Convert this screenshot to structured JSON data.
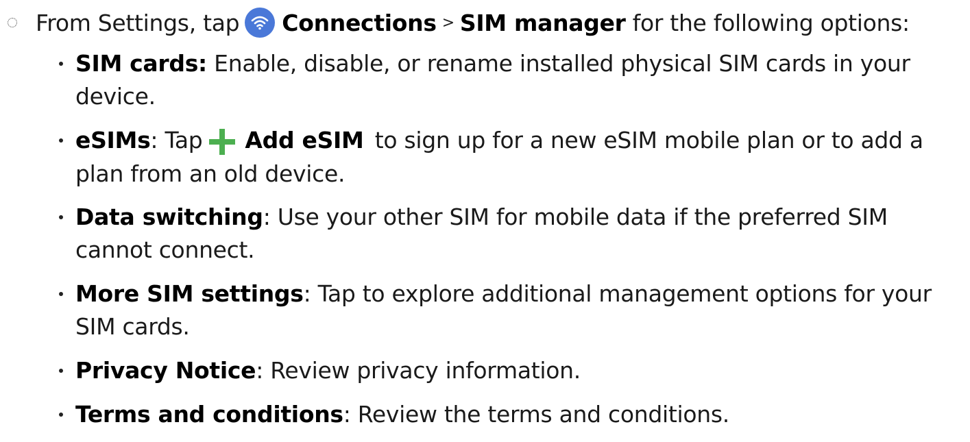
{
  "intro": {
    "prefix": "From Settings, tap",
    "connections": "Connections",
    "separator": ">",
    "sim_manager": "SIM manager",
    "suffix": "for the following options:",
    "connections_icon": "wifi-icon",
    "icon_color": "#4a78d8"
  },
  "options": [
    {
      "term": "SIM cards:",
      "text": "Enable, disable, or rename installed physical SIM cards in your device."
    },
    {
      "term": "eSIMs",
      "colon": ":",
      "text_before": "Tap",
      "action_icon": "plus-icon",
      "action_icon_color": "#4caf50",
      "action_label": "Add eSIM",
      "text_after": "to sign up for a new eSIM mobile plan or to add a plan from an old device."
    },
    {
      "term": "Data switching",
      "colon": ":",
      "text": "Use your other SIM for mobile data if the preferred SIM cannot connect."
    },
    {
      "term": "More SIM settings",
      "colon": ":",
      "text": "Tap to explore additional management options for your SIM cards."
    },
    {
      "term": "Privacy Notice",
      "colon": ":",
      "text": "Review privacy information."
    },
    {
      "term": "Terms and conditions",
      "colon": ":",
      "text": "Review the terms and conditions."
    }
  ]
}
